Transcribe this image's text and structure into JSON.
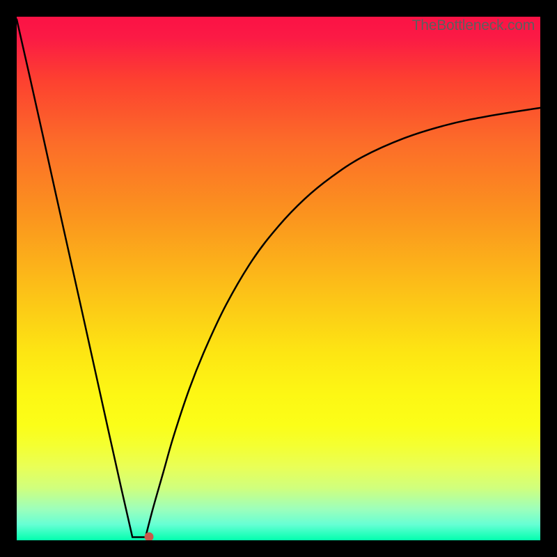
{
  "watermark": "TheBottleneck.com",
  "chart_data": {
    "type": "line",
    "title": "",
    "xlabel": "",
    "ylabel": "",
    "xlim": [
      0,
      100
    ],
    "ylim": [
      0,
      100
    ],
    "grid": false,
    "background": "vertical-gradient red-top green-bottom",
    "series": [
      {
        "name": "left-descent",
        "x": [
          0.0,
          2.5,
          5.0,
          7.5,
          10.0,
          12.5,
          15.0,
          17.5,
          20.0,
          22.1,
          24.6
        ],
        "values": [
          99.5,
          88.5,
          77.3,
          66.0,
          54.8,
          43.6,
          32.3,
          21.0,
          9.8,
          0.6,
          0.6
        ]
      },
      {
        "name": "right-ascent",
        "x": [
          24.6,
          26.0,
          28.0,
          30.0,
          33.0,
          36.0,
          40.0,
          45.0,
          50.0,
          55.0,
          60.0,
          66.0,
          74.0,
          82.0,
          90.0,
          100.0
        ],
        "values": [
          0.6,
          6.0,
          13.0,
          20.0,
          29.0,
          36.5,
          45.0,
          53.5,
          60.0,
          65.2,
          69.3,
          73.2,
          76.8,
          79.3,
          81.0,
          82.6
        ]
      }
    ],
    "marker": {
      "x": 25.2,
      "y": 0.6,
      "color": "#c8594b"
    }
  }
}
